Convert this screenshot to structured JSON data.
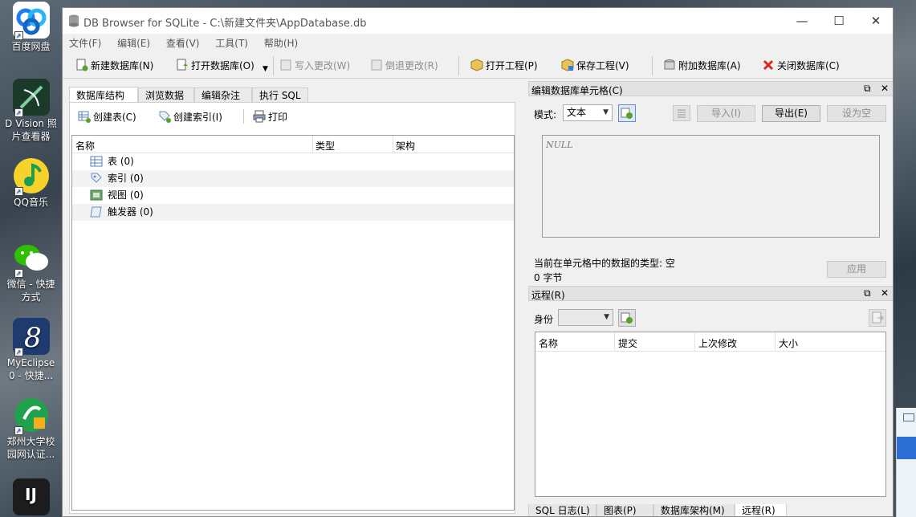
{
  "desktop": {
    "icons": [
      {
        "label": "百度网盘",
        "color": "#1e7cf2"
      },
      {
        "label": "D Vision 照\n片查看器",
        "color": "#2a8f3c"
      },
      {
        "label": "QQ音乐",
        "color": "#f7d22a"
      },
      {
        "label": "微信 - 快捷\n方式",
        "color": "#2dc100"
      },
      {
        "label": "MyEclipse\n0 - 快捷...",
        "color": "#1d3b6e"
      },
      {
        "label": "郑州大学校\n园网认证...",
        "color": "#1fa24b"
      },
      {
        "label": "IJ",
        "color": "#1c1c1c"
      }
    ]
  },
  "window": {
    "title": "DB Browser for SQLite - C:\\新建文件夹\\AppDatabase.db",
    "controls": {
      "minimize": "—",
      "maximize": "☐",
      "close": "✕"
    }
  },
  "menu": [
    "文件(F)",
    "编辑(E)",
    "查看(V)",
    "工具(T)",
    "帮助(H)"
  ],
  "toolbar": {
    "new_db": "新建数据库(N)",
    "open_db": "打开数据库(O)",
    "write_changes": "写入更改(W)",
    "revert_changes": "倒退更改(R)",
    "open_project": "打开工程(P)",
    "save_project": "保存工程(V)",
    "attach_db": "附加数据库(A)",
    "close_db": "关闭数据库(C)"
  },
  "tabs": [
    "数据库结构",
    "浏览数据",
    "编辑杂注",
    "执行 SQL"
  ],
  "structure": {
    "create_table": "创建表(C)",
    "create_index": "创建索引(I)",
    "print": "打印",
    "columns": [
      "名称",
      "类型",
      "架构"
    ],
    "items": [
      {
        "label": "表 (0)",
        "icon": "table-icon"
      },
      {
        "label": "索引 (0)",
        "icon": "index-icon"
      },
      {
        "label": "视图 (0)",
        "icon": "view-icon"
      },
      {
        "label": "触发器 (0)",
        "icon": "trigger-icon"
      }
    ]
  },
  "edit_cell": {
    "title": "编辑数据库单元格(C)",
    "mode_label": "模式:",
    "mode_value": "文本",
    "import": "导入(I)",
    "export": "导出(E)",
    "set_null": "设为空",
    "null_text": "NULL",
    "type_text": "当前在单元格中的数据的类型: 空",
    "size_text": "0 字节",
    "apply": "应用"
  },
  "remote": {
    "title": "远程(R)",
    "identity_label": "身份",
    "columns": [
      "名称",
      "提交",
      "上次修改",
      "大小"
    ]
  },
  "bottom_tabs": [
    "SQL 日志(L)",
    "图表(P)",
    "数据库架构(M)",
    "远程(R)"
  ],
  "colors": {
    "accent_green": "#5aa02c",
    "close_red": "#d9281e"
  }
}
